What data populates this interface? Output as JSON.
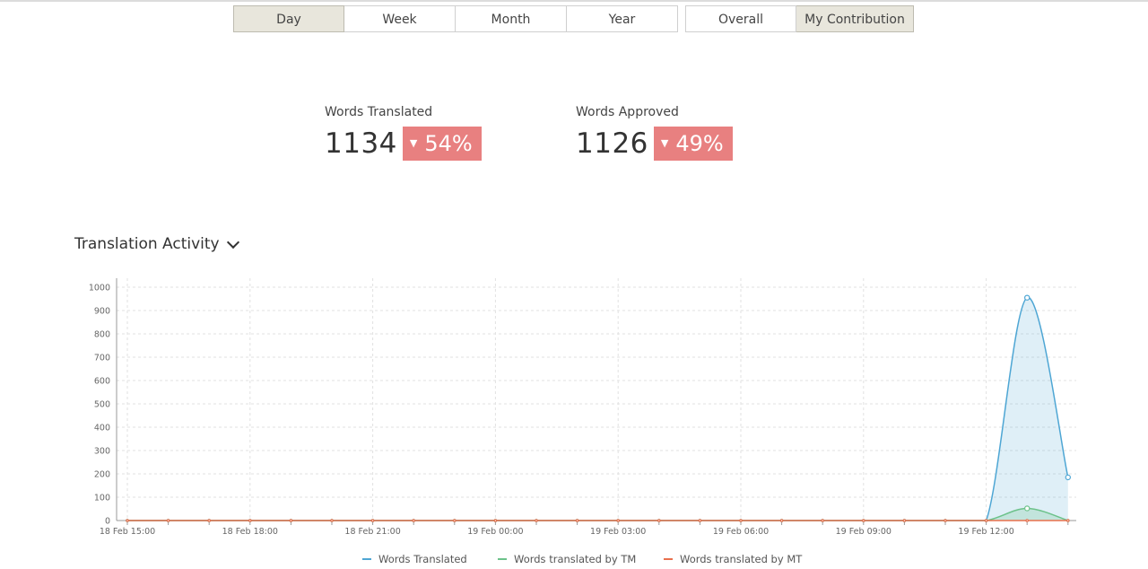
{
  "filters": {
    "period": [
      {
        "label": "Day",
        "active": true
      },
      {
        "label": "Week",
        "active": false
      },
      {
        "label": "Month",
        "active": false
      },
      {
        "label": "Year",
        "active": false
      }
    ],
    "scope": [
      {
        "label": "Overall",
        "active": false
      },
      {
        "label": "My Contribution",
        "active": true
      }
    ]
  },
  "stats": {
    "translated": {
      "label": "Words Translated",
      "value": "1134",
      "change": "54%",
      "direction": "down"
    },
    "approved": {
      "label": "Words Approved",
      "value": "1126",
      "change": "49%",
      "direction": "down"
    }
  },
  "section": {
    "title": "Translation Activity",
    "icon": "chevron-down-icon"
  },
  "colors": {
    "translated": "#4ea6d4",
    "tm": "#6cc28a",
    "mt": "#e8704d",
    "badge": "#e88080",
    "active_btn": "#e8e6dc"
  },
  "chart_data": {
    "type": "area",
    "ylim": [
      0,
      1000
    ],
    "yticks": [
      0,
      100,
      200,
      300,
      400,
      500,
      600,
      700,
      800,
      900,
      1000
    ],
    "xtick_labels": [
      "18 Feb 15:00",
      "18 Feb 18:00",
      "18 Feb 21:00",
      "19 Feb 00:00",
      "19 Feb 03:00",
      "19 Feb 06:00",
      "19 Feb 09:00",
      "19 Feb 12:00"
    ],
    "x": [
      "18 Feb 15:00",
      "18 Feb 16:00",
      "18 Feb 17:00",
      "18 Feb 18:00",
      "18 Feb 19:00",
      "18 Feb 20:00",
      "18 Feb 21:00",
      "18 Feb 22:00",
      "18 Feb 23:00",
      "19 Feb 00:00",
      "19 Feb 01:00",
      "19 Feb 02:00",
      "19 Feb 03:00",
      "19 Feb 04:00",
      "19 Feb 05:00",
      "19 Feb 06:00",
      "19 Feb 07:00",
      "19 Feb 08:00",
      "19 Feb 09:00",
      "19 Feb 10:00",
      "19 Feb 11:00",
      "19 Feb 12:00",
      "19 Feb 13:00",
      "19 Feb 14:00"
    ],
    "series": [
      {
        "name": "Words Translated",
        "values": [
          0,
          0,
          0,
          0,
          0,
          0,
          0,
          0,
          0,
          0,
          0,
          0,
          0,
          0,
          0,
          0,
          0,
          0,
          0,
          0,
          0,
          0,
          955,
          185
        ]
      },
      {
        "name": "Words translated by TM",
        "values": [
          0,
          0,
          0,
          0,
          0,
          0,
          0,
          0,
          0,
          0,
          0,
          0,
          0,
          0,
          0,
          0,
          0,
          0,
          0,
          0,
          0,
          0,
          52,
          0
        ]
      },
      {
        "name": "Words translated by MT",
        "values": [
          0,
          0,
          0,
          0,
          0,
          0,
          0,
          0,
          0,
          0,
          0,
          0,
          0,
          0,
          0,
          0,
          0,
          0,
          0,
          0,
          0,
          0,
          0,
          0
        ]
      }
    ],
    "grid": true,
    "legend": "bottom"
  }
}
